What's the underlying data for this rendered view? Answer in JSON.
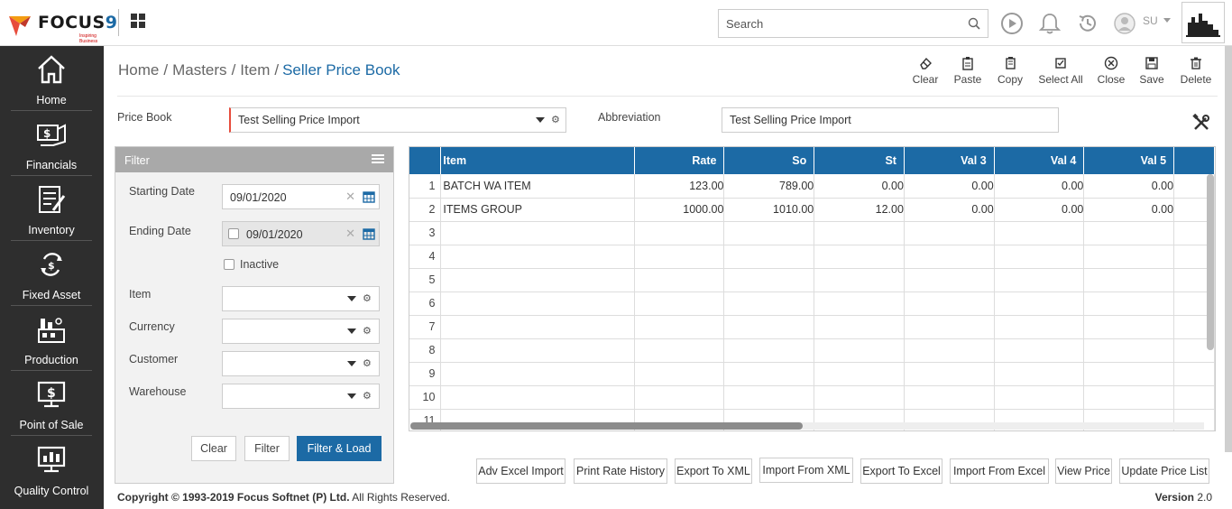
{
  "app": {
    "logo_text": "FOCUS",
    "logo_num": "9",
    "logo_tagline": "Inspiring Business"
  },
  "header": {
    "search_placeholder": "Search",
    "user": "SU"
  },
  "sidebar": {
    "items": [
      {
        "label": "Home",
        "icon": "home-icon"
      },
      {
        "label": "Financials",
        "icon": "financials-icon"
      },
      {
        "label": "Inventory",
        "icon": "inventory-icon"
      },
      {
        "label": "Fixed Asset",
        "icon": "fixed-asset-icon"
      },
      {
        "label": "Production",
        "icon": "production-icon"
      },
      {
        "label": "Point of Sale",
        "icon": "point-of-sale-icon"
      },
      {
        "label": "Quality Control",
        "icon": "quality-control-icon"
      }
    ]
  },
  "breadcrumb": {
    "home": "Home",
    "masters": "Masters",
    "item": "Item",
    "current": "Seller Price Book"
  },
  "toolbar": {
    "clear": "Clear",
    "paste": "Paste",
    "copy": "Copy",
    "select_all": "Select All",
    "close": "Close",
    "save": "Save",
    "delete": "Delete"
  },
  "form": {
    "price_book_label": "Price Book",
    "price_book_value": "Test Selling Price Import",
    "abbreviation_label": "Abbreviation",
    "abbreviation_value": "Test Selling Price Import"
  },
  "filter": {
    "title": "Filter",
    "starting_date_label": "Starting Date",
    "starting_date_value": "09/01/2020",
    "ending_date_label": "Ending Date",
    "ending_date_value": "09/01/2020",
    "inactive_label": "Inactive",
    "item_label": "Item",
    "currency_label": "Currency",
    "customer_label": "Customer",
    "warehouse_label": "Warehouse",
    "clear_btn": "Clear",
    "filter_btn": "Filter",
    "filter_load_btn": "Filter & Load"
  },
  "grid": {
    "columns": [
      "Item",
      "Rate",
      "So",
      "St",
      "Val 3",
      "Val 4",
      "Val 5"
    ],
    "rows": [
      {
        "num": "1",
        "item": "BATCH WA ITEM",
        "rate": "123.00",
        "so": "789.00",
        "st": "0.00",
        "val3": "0.00",
        "val4": "0.00",
        "val5": "0.00"
      },
      {
        "num": "2",
        "item": "ITEMS GROUP",
        "rate": "1000.00",
        "so": "1010.00",
        "st": "12.00",
        "val3": "0.00",
        "val4": "0.00",
        "val5": "0.00"
      },
      {
        "num": "3"
      },
      {
        "num": "4"
      },
      {
        "num": "5"
      },
      {
        "num": "6"
      },
      {
        "num": "7"
      },
      {
        "num": "8"
      },
      {
        "num": "9"
      },
      {
        "num": "10"
      },
      {
        "num": "11"
      }
    ]
  },
  "actions": {
    "adv_excel_import": "Adv Excel Import",
    "print_rate_history": "Print Rate History",
    "export_to_xml": "Export To XML",
    "import_from_xml": "Import From XML",
    "export_to_excel": "Export To Excel",
    "import_from_excel": "Import From Excel",
    "view_price": "View Price",
    "update_price_list": "Update Price List"
  },
  "footer": {
    "copyright_bold": "Copyright © 1993-2019 Focus Softnet (P) Ltd.",
    "copyright_rest": " All Rights Reserved.",
    "version_label": "Version",
    "version_num": "2.0"
  },
  "colors": {
    "accent": "#1c6aa5",
    "sidebar_bg": "#2e2e2e",
    "required": "#e74c3c"
  }
}
